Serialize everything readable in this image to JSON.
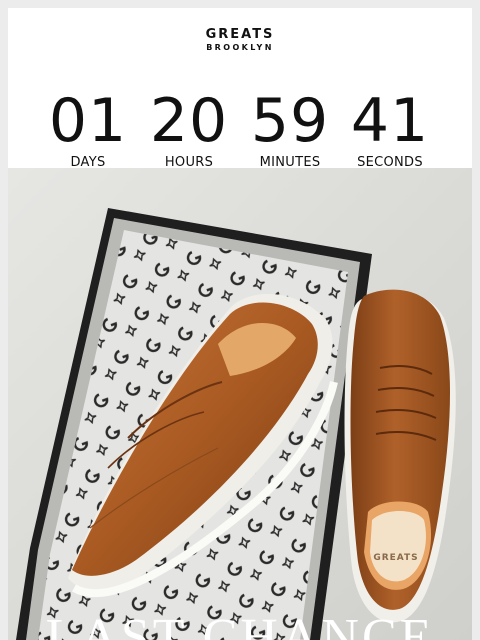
{
  "brand": {
    "line1": "GREATS",
    "line2": "BROOKLYN"
  },
  "countdown": [
    {
      "value": "01",
      "label": "DAYS"
    },
    {
      "value": "20",
      "label": "HOURS"
    },
    {
      "value": "59",
      "label": "MINUTES"
    },
    {
      "value": "41",
      "label": "SECONDS"
    }
  ],
  "hero": {
    "headline": "LAST CHANCE",
    "insole_text": "GREATS",
    "colors": {
      "background": "#d8d8d5",
      "leather": "#b5642a",
      "sole": "#f2f0ea",
      "box": "#2c2c2c",
      "tissue": "#e2e2e0"
    }
  }
}
